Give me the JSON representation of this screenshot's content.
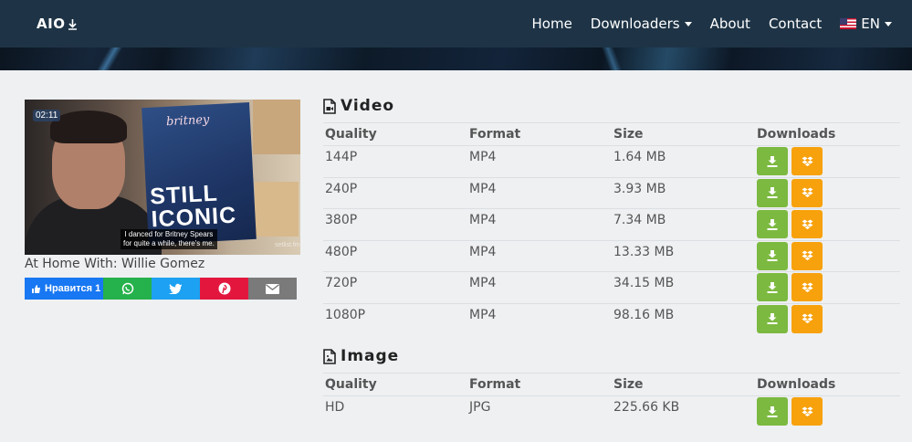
{
  "header": {
    "logo_text": "AIO",
    "nav": [
      {
        "label": "Home"
      },
      {
        "label": "Downloaders"
      },
      {
        "label": "About"
      },
      {
        "label": "Contact"
      }
    ],
    "language": "EN"
  },
  "video": {
    "duration": "02:11",
    "thumbnail": {
      "book_title": "britney",
      "book_text_1": "STILL",
      "book_text_2": "ICONIC",
      "caption_1": "I danced for Britney Spears",
      "caption_2": "for quite a while, there's me.",
      "watermark": "setlist.fm"
    },
    "title": "At Home With: Willie Gomez"
  },
  "share": {
    "facebook_label": "Нравится 1"
  },
  "video_section": {
    "title": "Video",
    "headers": {
      "quality": "Quality",
      "format": "Format",
      "size": "Size",
      "downloads": "Downloads"
    },
    "rows": [
      {
        "quality": "144P",
        "format": "MP4",
        "size": "1.64 MB"
      },
      {
        "quality": "240P",
        "format": "MP4",
        "size": "3.93 MB"
      },
      {
        "quality": "380P",
        "format": "MP4",
        "size": "7.34 MB"
      },
      {
        "quality": "480P",
        "format": "MP4",
        "size": "13.33 MB"
      },
      {
        "quality": "720P",
        "format": "MP4",
        "size": "34.15 MB"
      },
      {
        "quality": "1080P",
        "format": "MP4",
        "size": "98.16 MB"
      }
    ]
  },
  "image_section": {
    "title": "Image",
    "headers": {
      "quality": "Quality",
      "format": "Format",
      "size": "Size",
      "downloads": "Downloads"
    },
    "rows": [
      {
        "quality": "HD",
        "format": "JPG",
        "size": "225.66 KB"
      }
    ]
  },
  "colors": {
    "navbar": "#1e3446",
    "download_green": "#7cb940",
    "dropbox_orange": "#f7a10c"
  },
  "icons": {
    "download": "download-icon",
    "dropbox": "dropbox-icon",
    "video_file": "video-file-icon",
    "image_file": "image-file-icon"
  }
}
